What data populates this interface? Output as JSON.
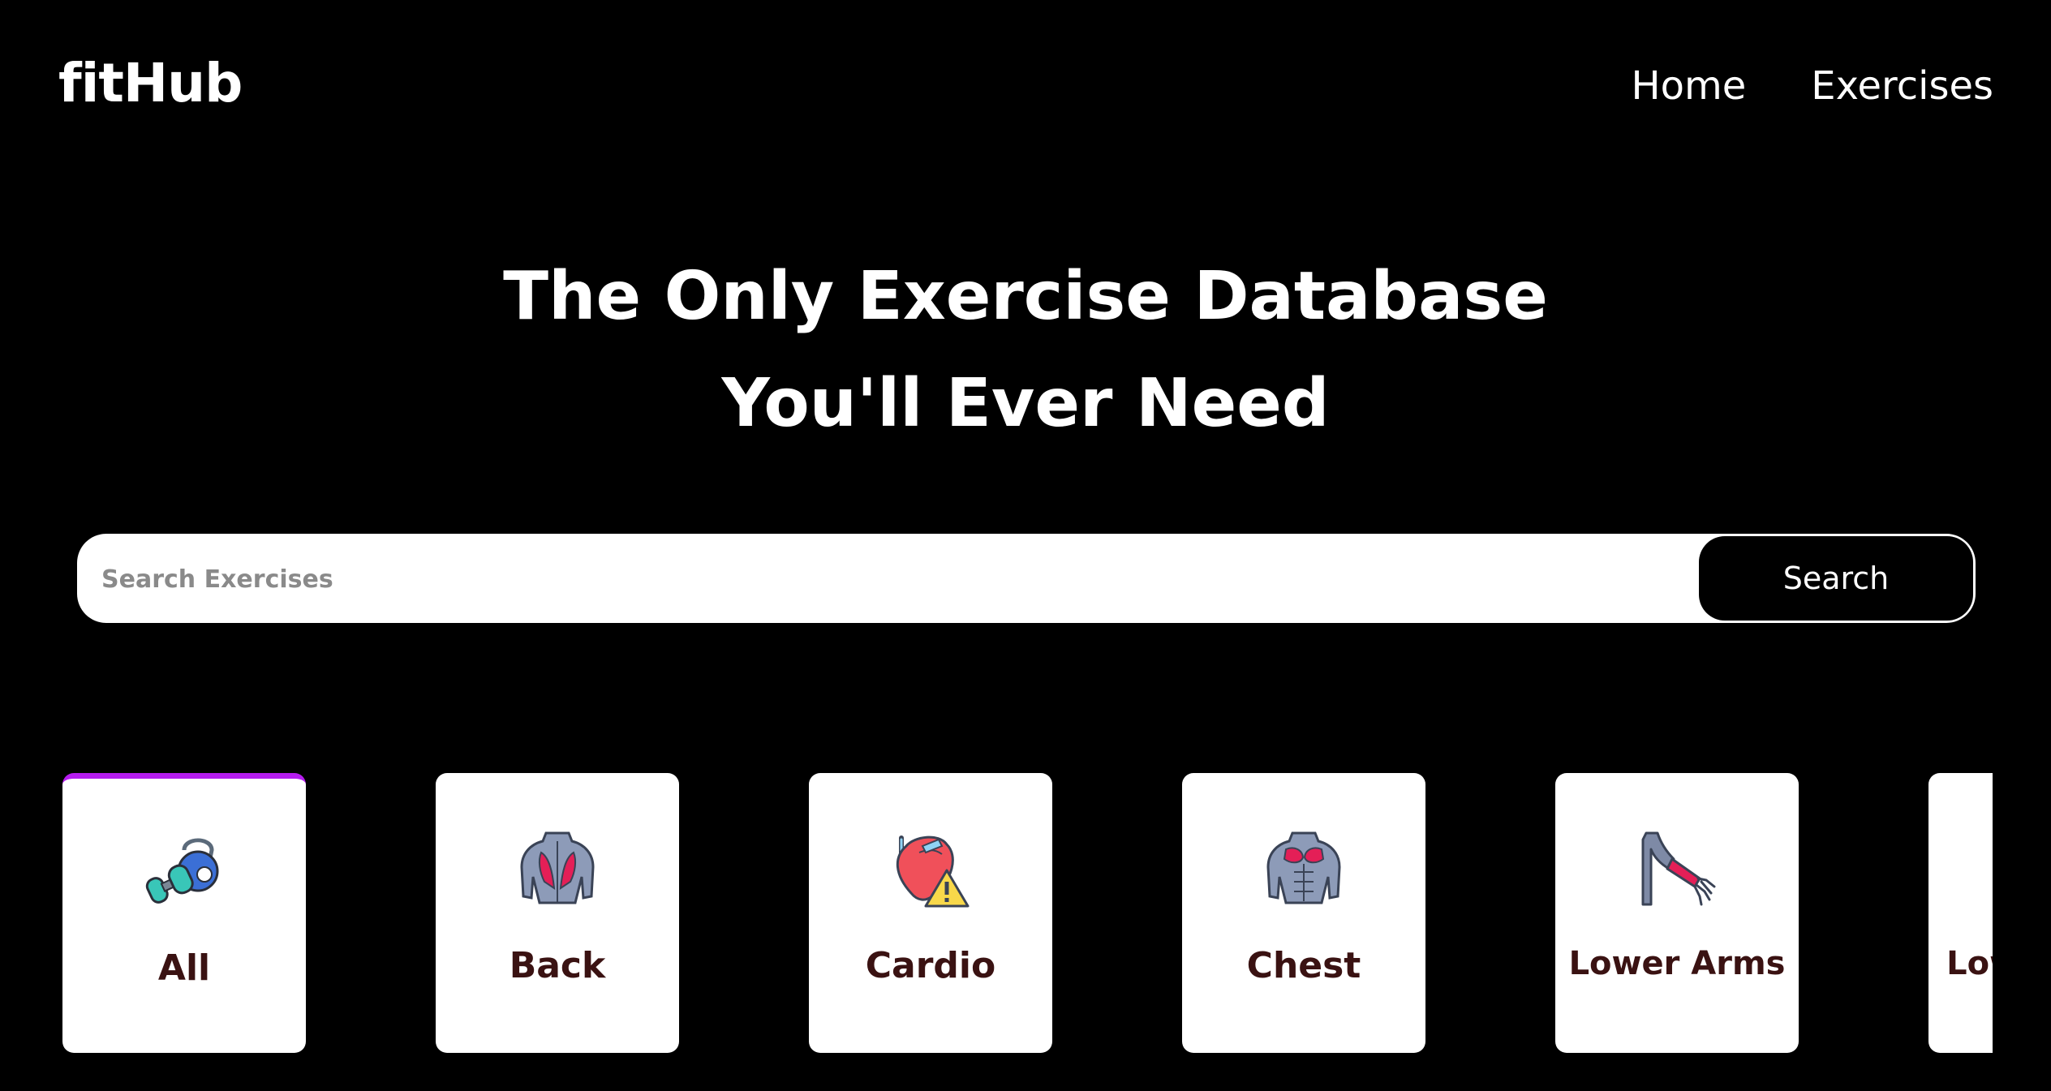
{
  "header": {
    "logo": "fitHub",
    "nav": [
      {
        "label": "Home"
      },
      {
        "label": "Exercises"
      }
    ]
  },
  "hero": {
    "line1": "The Only Exercise Database",
    "line2": "You'll Ever Need"
  },
  "search": {
    "placeholder": "Search Exercises",
    "value": "",
    "button_label": "Search"
  },
  "categories": {
    "selected": "All",
    "accent_color": "#b61cf0",
    "items": [
      {
        "label": "All",
        "icon": "kettlebell-dumbbell-icon"
      },
      {
        "label": "Back",
        "icon": "back-muscle-icon"
      },
      {
        "label": "Cardio",
        "icon": "heart-warning-icon"
      },
      {
        "label": "Chest",
        "icon": "chest-muscle-icon"
      },
      {
        "label": "Lower Arms",
        "icon": "forearm-muscle-icon"
      },
      {
        "label": "Lower Legs",
        "icon": "lower-leg-icon"
      }
    ]
  }
}
